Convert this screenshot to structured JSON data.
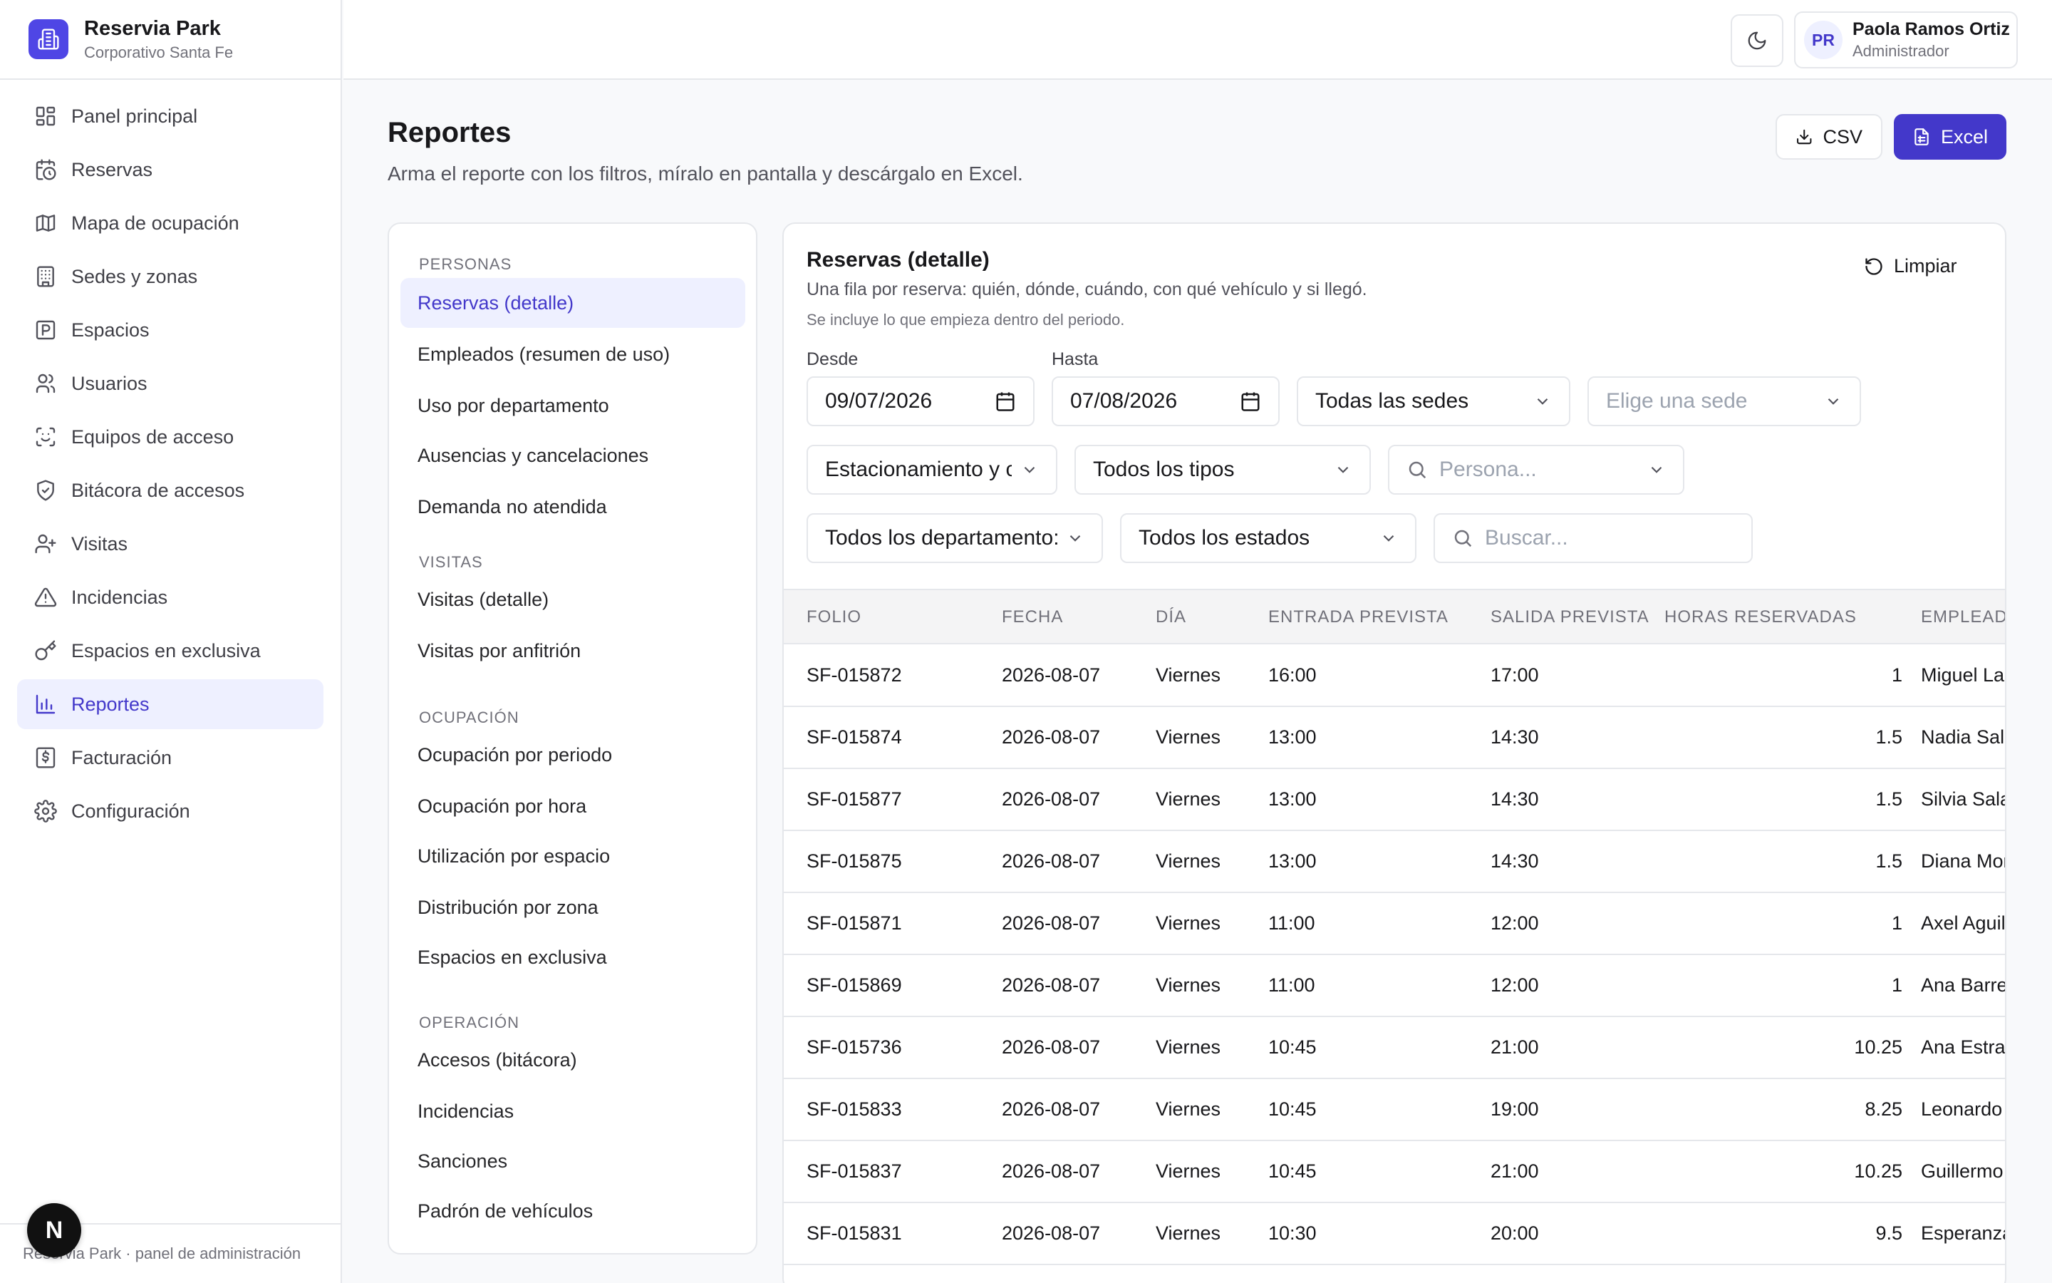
{
  "brand": {
    "name": "Reservia Park",
    "subtitle": "Corporativo Santa Fe"
  },
  "sidebar": {
    "items": [
      {
        "label": "Panel principal",
        "icon": "dashboard-icon",
        "active": false
      },
      {
        "label": "Reservas",
        "icon": "calendar-clock-icon",
        "active": false
      },
      {
        "label": "Mapa de ocupación",
        "icon": "map-icon",
        "active": false
      },
      {
        "label": "Sedes y zonas",
        "icon": "building-icon",
        "active": false
      },
      {
        "label": "Espacios",
        "icon": "parking-icon",
        "active": false
      },
      {
        "label": "Usuarios",
        "icon": "users-icon",
        "active": false
      },
      {
        "label": "Equipos de acceso",
        "icon": "scan-icon",
        "active": false
      },
      {
        "label": "Bitácora de accesos",
        "icon": "shield-check-icon",
        "active": false
      },
      {
        "label": "Visitas",
        "icon": "user-plus-icon",
        "active": false
      },
      {
        "label": "Incidencias",
        "icon": "alert-triangle-icon",
        "active": false
      },
      {
        "label": "Espacios en exclusiva",
        "icon": "key-icon",
        "active": false
      },
      {
        "label": "Reportes",
        "icon": "bar-chart-icon",
        "active": true
      },
      {
        "label": "Facturación",
        "icon": "receipt-icon",
        "active": false
      },
      {
        "label": "Configuración",
        "icon": "gear-icon",
        "active": false
      }
    ],
    "footer": "Reservia Park · panel de administración"
  },
  "next_badge": "N",
  "user": {
    "initials": "PR",
    "name": "Paola Ramos Ortiz",
    "role": "Administrador"
  },
  "page": {
    "title": "Reportes",
    "subtitle": "Arma el reporte con los filtros, míralo en pantalla y descárgalo en Excel.",
    "csv_label": "CSV",
    "excel_label": "Excel"
  },
  "report_groups": [
    {
      "label": "PERSONAS",
      "items": [
        "Reservas (detalle)",
        "Empleados (resumen de uso)",
        "Uso por departamento",
        "Ausencias y cancelaciones",
        "Demanda no atendida"
      ]
    },
    {
      "label": "VISITAS",
      "items": [
        "Visitas (detalle)",
        "Visitas por anfitrión"
      ]
    },
    {
      "label": "OCUPACIÓN",
      "items": [
        "Ocupación por periodo",
        "Ocupación por hora",
        "Utilización por espacio",
        "Distribución por zona",
        "Espacios en exclusiva"
      ]
    },
    {
      "label": "OPERACIÓN",
      "items": [
        "Accesos (bitácora)",
        "Incidencias",
        "Sanciones",
        "Padrón de vehículos"
      ]
    }
  ],
  "active_report": "Reservas (detalle)",
  "detail": {
    "title": "Reservas (detalle)",
    "description": "Una fila por reserva: quién, dónde, cuándo, con qué vehículo y si llegó.",
    "note": "Se incluye lo que empieza dentro del periodo.",
    "clear_label": "Limpiar"
  },
  "filters": {
    "desde_label": "Desde",
    "desde_value": "09/07/2026",
    "hasta_label": "Hasta",
    "hasta_value": "07/08/2026",
    "sede_value": "Todas las sedes",
    "zona_placeholder": "Elige una sede",
    "espacio_value": "Estacionamiento y c",
    "tipo_value": "Todos los tipos",
    "persona_placeholder": "Persona...",
    "departamento_value": "Todos los departamento:",
    "estado_value": "Todos los estados",
    "buscar_placeholder": "Buscar..."
  },
  "table": {
    "columns": [
      "FOLIO",
      "FECHA",
      "DÍA",
      "ENTRADA PREVISTA",
      "SALIDA PREVISTA",
      "HORAS RESERVADAS",
      "EMPLEAD"
    ],
    "rows": [
      [
        "SF-015872",
        "2026-08-07",
        "Viernes",
        "16:00",
        "17:00",
        "1",
        "Miguel La"
      ],
      [
        "SF-015874",
        "2026-08-07",
        "Viernes",
        "13:00",
        "14:30",
        "1.5",
        "Nadia Sala"
      ],
      [
        "SF-015877",
        "2026-08-07",
        "Viernes",
        "13:00",
        "14:30",
        "1.5",
        "Silvia Sala"
      ],
      [
        "SF-015875",
        "2026-08-07",
        "Viernes",
        "13:00",
        "14:30",
        "1.5",
        "Diana Mor"
      ],
      [
        "SF-015871",
        "2026-08-07",
        "Viernes",
        "11:00",
        "12:00",
        "1",
        "Axel Aguil"
      ],
      [
        "SF-015869",
        "2026-08-07",
        "Viernes",
        "11:00",
        "12:00",
        "1",
        "Ana Barre"
      ],
      [
        "SF-015736",
        "2026-08-07",
        "Viernes",
        "10:45",
        "21:00",
        "10.25",
        "Ana Estra"
      ],
      [
        "SF-015833",
        "2026-08-07",
        "Viernes",
        "10:45",
        "19:00",
        "8.25",
        "Leonardo"
      ],
      [
        "SF-015837",
        "2026-08-07",
        "Viernes",
        "10:45",
        "21:00",
        "10.25",
        "Guillermo"
      ],
      [
        "SF-015831",
        "2026-08-07",
        "Viernes",
        "10:30",
        "20:00",
        "9.5",
        "Esperanza"
      ]
    ]
  },
  "colors": {
    "accent": "#4338ca",
    "accent_bg": "#eef0ff",
    "border": "#e5e7eb",
    "muted": "#71717a"
  }
}
